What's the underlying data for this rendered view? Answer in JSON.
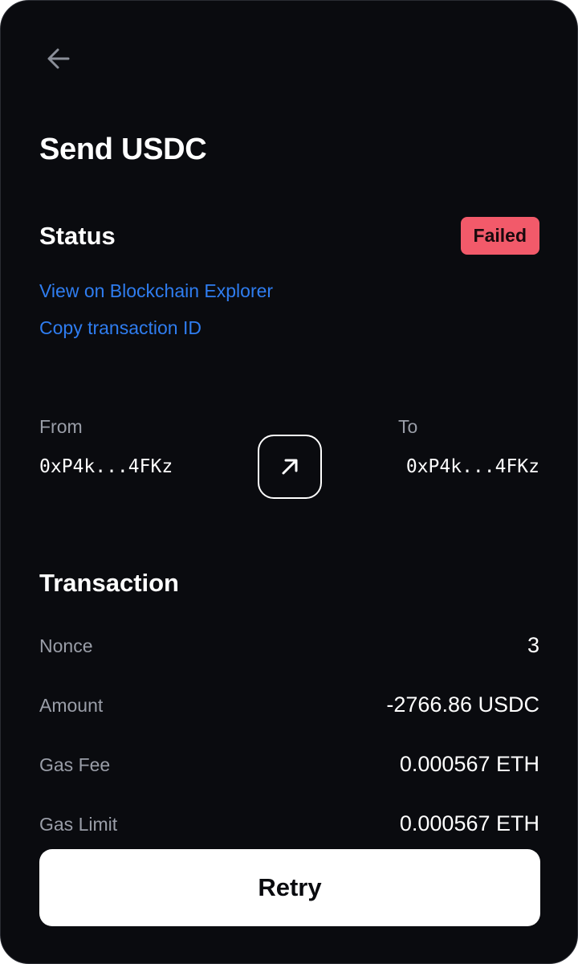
{
  "header": {
    "back_icon": "arrow-left-icon",
    "title": "Send USDC"
  },
  "status": {
    "heading": "Status",
    "badge": "Failed",
    "badge_color": "#f25a6a",
    "links": {
      "explorer": "View on Blockchain Explorer",
      "copy_id": "Copy transaction ID"
    },
    "link_color": "#2f7df0"
  },
  "transfer": {
    "from_label": "From",
    "from_address": "0xP4k...4FKz",
    "icon": "arrow-up-right-icon",
    "to_label": "To",
    "to_address": "0xP4k...4FKz"
  },
  "transaction": {
    "heading": "Transaction",
    "rows": [
      {
        "label": "Nonce",
        "value": "3"
      },
      {
        "label": "Amount",
        "value": "-2766.86 USDC"
      },
      {
        "label": "Gas Fee",
        "value": "0.000567 ETH"
      },
      {
        "label": "Gas Limit",
        "value": "0.000567 ETH"
      }
    ]
  },
  "actions": {
    "retry_label": "Retry"
  },
  "colors": {
    "background": "#0a0b0f",
    "text_primary": "#ffffff",
    "text_secondary": "#9a9ea8"
  }
}
